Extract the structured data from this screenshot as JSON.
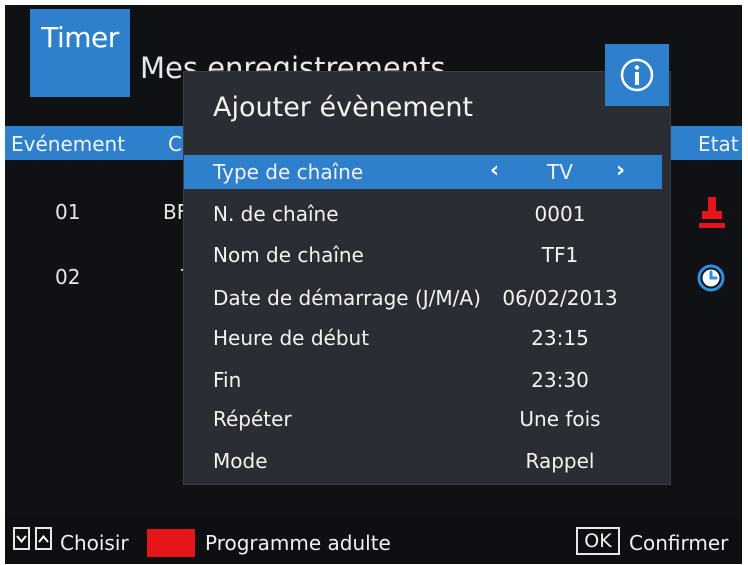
{
  "header": {
    "timer_tab": "Timer",
    "page_title": "Mes enregistrements"
  },
  "columns": {
    "event": "Evénement",
    "channel": "Ch",
    "state": "Etat"
  },
  "background_rows": [
    {
      "number": "01",
      "channel_partial": "BF",
      "state_icon": "record-icon"
    },
    {
      "number": "02",
      "channel_partial": "T",
      "state_icon": "clock-icon"
    }
  ],
  "modal": {
    "title": "Ajouter évènement",
    "info_icon": "info-icon",
    "rows": [
      {
        "label": "Type de chaîne",
        "value": "TV"
      },
      {
        "label": "N. de chaîne",
        "value": "0001"
      },
      {
        "label": "Nom de chaîne",
        "value": "TF1"
      },
      {
        "label": "Date de démarrage (J/M/A)",
        "value": "06/02/2013"
      },
      {
        "label": "Heure de début",
        "value": "23:15"
      },
      {
        "label": "Fin",
        "value": "23:30"
      },
      {
        "label": "Répéter",
        "value": "Une fois"
      },
      {
        "label": "Mode",
        "value": "Rappel"
      }
    ],
    "left_arrow": "‹",
    "right_arrow": "›"
  },
  "footer": {
    "choose_label": "Choisir",
    "adult_label": "Programme adulte",
    "ok_key": "OK",
    "confirm_label": "Confirmer"
  },
  "colors": {
    "accent_blue": "#2e7fcc",
    "background": "#101114",
    "modal_bg": "#2a2d33",
    "red_key": "#e4161a",
    "record_icon": "#e4161a"
  }
}
